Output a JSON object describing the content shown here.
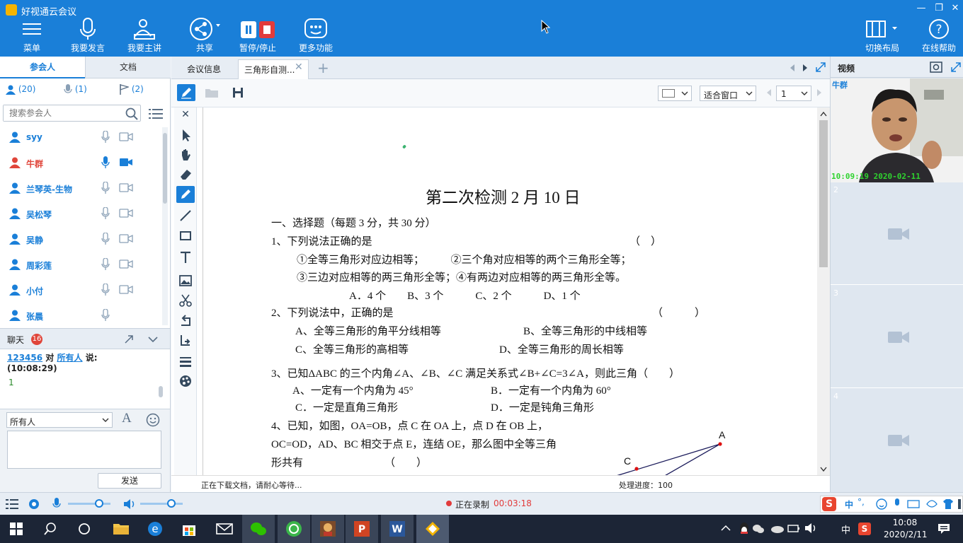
{
  "app": {
    "title": "好视通云会议"
  },
  "toolbar": {
    "menu": "菜单",
    "speak": "我要发言",
    "present": "我要主讲",
    "share": "共享",
    "pause_stop": "暂停/停止",
    "more": "更多功能",
    "switch_layout": "切换布局",
    "help": "在线帮助"
  },
  "left": {
    "tab_participants": "参会人",
    "tab_docs": "文档",
    "count_all": "(20)",
    "count_speaking": "(1)",
    "count_flag": "(2)",
    "search_placeholder": "搜索参会人",
    "participants": [
      {
        "name": "syy"
      },
      {
        "name": "牛群"
      },
      {
        "name": "兰琴英-生物"
      },
      {
        "name": "吴松琴"
      },
      {
        "name": "吴静"
      },
      {
        "name": "周彩莲"
      },
      {
        "name": "小付"
      },
      {
        "name": "张晨"
      }
    ],
    "chat_label": "聊天",
    "chat_badge": "16",
    "chat_sender": "123456",
    "chat_to_word": "对",
    "chat_target": "所有人",
    "chat_says": "说:",
    "chat_time": "(10:08:29)",
    "chat_message": "1",
    "recipient": "所有人",
    "send": "发送"
  },
  "center": {
    "tab_info": "会议信息",
    "tab_doc": "三角形自测...",
    "zoom": "适合窗口",
    "page": "1",
    "status_left": "正在下载文档，请耐心等待...",
    "status_right": "处理进度：100",
    "doc": {
      "title": "第二次检测 2 月 10 日",
      "lines": [
        "一、选择题（每题 3 分，共 30 分）",
        "1、下列说法正确的是",
        "（　）",
        "①全等三角形对应边相等；　　　②三个角对应相等的两个三角形全等；",
        "③三边对应相等的两三角形全等；④有两边对应相等的两三角形全等。",
        "A．4 个　　B、3 个　　　C、2 个　　　D、1 个",
        "2、下列说法中，正确的是",
        "（　　　）",
        "A、全等三角形的角平分线相等",
        "B、全等三角形的中线相等",
        "C、全等三角形的高相等",
        "D、全等三角形的周长相等",
        "3、已知ΔABC 的三个内角∠A、∠B、∠C 满足关系式∠B+∠C=3∠A，则此三角（　　）",
        "A、一定有一个内角为 45°",
        "B．一定有一个内角为 60°",
        "C．一定是直角三角形",
        "D．一定是钝角三角形",
        "4、已知，如图，OA=OB，点 C 在 OA 上，点 D 在 OB 上，",
        "OC=OD，AD、BC 相交于点 E，连结 OE，那么图中全等三角",
        "形共有",
        "（　　）"
      ],
      "figure_labels": [
        "A",
        "C"
      ]
    }
  },
  "right": {
    "video_label": "视频",
    "cam_name": "牛群",
    "cam_timestamp": "10:09:19 2020-02-11",
    "slots": [
      "2",
      "3",
      "4"
    ]
  },
  "bottom": {
    "recording": "正在录制",
    "rec_time": "00:03:18"
  },
  "taskbar": {
    "ime": "中",
    "time": "10:08",
    "date": "2020/2/11"
  },
  "colors": {
    "brand": "#1a7fd8",
    "rec": "#e23b3b",
    "active_user": "#e0453a"
  }
}
